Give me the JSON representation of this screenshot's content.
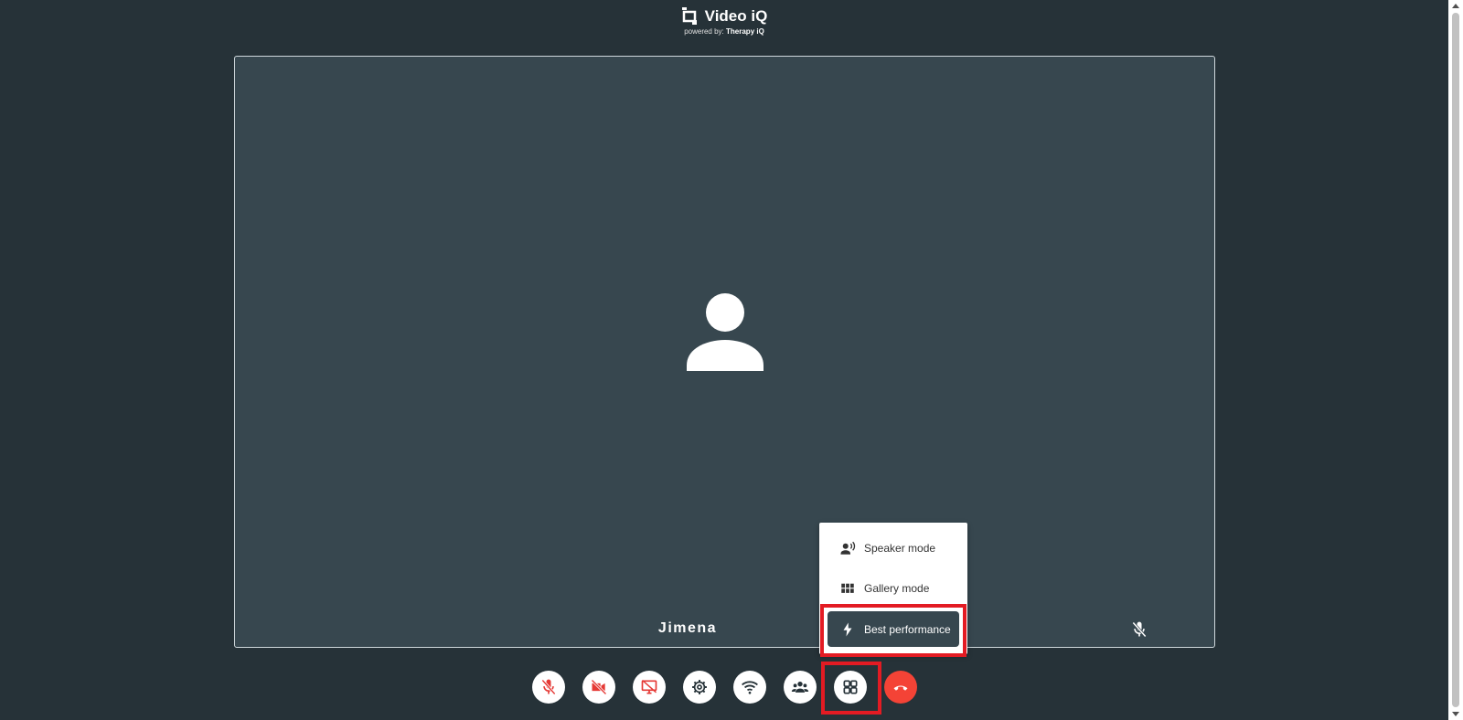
{
  "header": {
    "app_title": "Video iQ",
    "powered_by_prefix": "powered by:",
    "powered_by_brand": "Therapy iQ",
    "logo_icon": "video-iq-logo-icon"
  },
  "tile": {
    "participant_name": "Jimena",
    "avatar_icon": "person-icon",
    "mic_status_icon": "mic-off-icon"
  },
  "layout_menu": {
    "items": [
      {
        "label": "Speaker mode",
        "icon": "speaker-mode-icon"
      },
      {
        "label": "Gallery mode",
        "icon": "grid-icon"
      },
      {
        "label": "Best performance",
        "icon": "lightning-icon",
        "selected": true
      }
    ]
  },
  "toolbar": {
    "buttons": [
      {
        "icon": "mic-off-icon"
      },
      {
        "icon": "video-off-icon"
      },
      {
        "icon": "screen-share-off-icon"
      },
      {
        "icon": "gear-icon"
      },
      {
        "icon": "wifi-icon"
      },
      {
        "icon": "participants-icon"
      },
      {
        "icon": "layout-grid-icon"
      },
      {
        "icon": "end-call-icon"
      }
    ]
  },
  "colors": {
    "background": "#263238",
    "tile": "#37474f",
    "muted_red": "#e53935",
    "end_call": "#f44336",
    "highlight": "#e31b23"
  }
}
